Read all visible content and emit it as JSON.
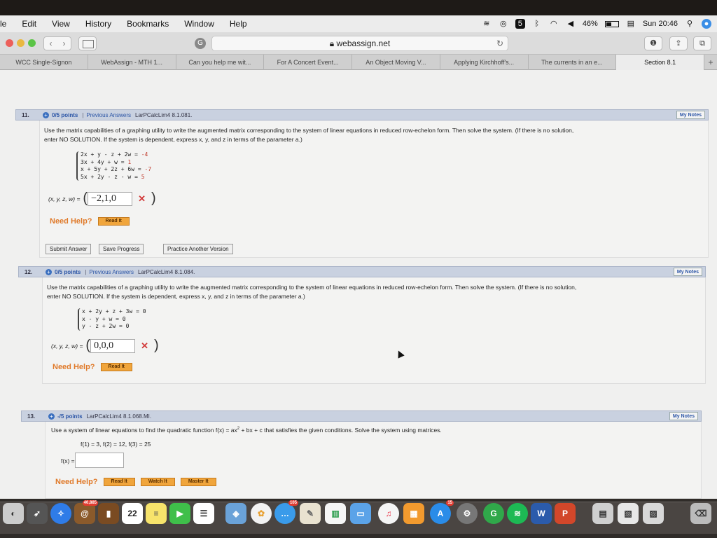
{
  "menubar": {
    "items": [
      "le",
      "Edit",
      "View",
      "History",
      "Bookmarks",
      "Window",
      "Help"
    ],
    "battery": "46%",
    "clock": "Sun 20:46",
    "battery_level": 0.46
  },
  "browser": {
    "url": "webassign.net",
    "tabs": [
      "WCC Single-Signon",
      "WebAssign - MTH 1...",
      "Can you help me wit...",
      "For A Concert Event...",
      "An Object Moving V...",
      "Applying Kirchhoff's...",
      "The currents in an e...",
      "Section 8.1"
    ],
    "active_tab_index": 7
  },
  "q11": {
    "number": "11.",
    "points": "0/5 points",
    "sep": "|",
    "prev": "Previous Answers",
    "source": "LarPCalcLim4 8.1.081.",
    "notes": "My Notes",
    "prompt_line1": "Use the matrix capabilities of a graphing utility to write the augmented matrix corresponding to the system of linear equations in reduced row-echelon form. Then solve the system. (If there is no solution,",
    "prompt_line2": "enter NO SOLUTION. If the system is dependent, express x, y, and z in terms of the parameter a.)",
    "eq1": "2x +  y -   z + 2w = ",
    "eq1_r": "-4",
    "eq2": "3x + 4y          +  w = ",
    "eq2_r": "1",
    "eq3": " x + 5y + 2z + 6w = ",
    "eq3_r": "-7",
    "eq4": "5x + 2y -   z -  w = ",
    "eq4_r": "5",
    "answer_label": "(x, y, z, w) =",
    "answer_value": "−2,1,0",
    "wrong": "✕",
    "need_help": "Need Help?",
    "read_it": "Read It",
    "submit": "Submit Answer",
    "save": "Save Progress",
    "practice": "Practice Another Version"
  },
  "q12": {
    "number": "12.",
    "points": "0/5 points",
    "sep": "|",
    "prev": "Previous Answers",
    "source": "LarPCalcLim4 8.1.084.",
    "notes": "My Notes",
    "prompt_line1": "Use the matrix capabilities of a graphing utility to write the augmented matrix corresponding to the system of linear equations in reduced row-echelon form. Then solve the system. (If there is no solution,",
    "prompt_line2": "enter NO SOLUTION. If the system is dependent, express x, y, and z in terms of the parameter a.)",
    "eq1": "x + 2y +  z + 3w = 0",
    "eq2": "x -   y         +  w = 0",
    "eq3": "      y -  z + 2w = 0",
    "answer_label": "(x, y, z, w) =",
    "answer_value": "0,0,0",
    "wrong": "✕",
    "need_help": "Need Help?",
    "read_it": "Read It"
  },
  "q13": {
    "number": "13.",
    "points": "-/5 points",
    "source": "LarPCalcLim4 8.1.068.MI.",
    "notes": "My Notes",
    "prompt_a": "Use a system of linear equations to find the quadratic function  f(x) = ax",
    "prompt_sup": "2",
    "prompt_b": " + bx + c  that satisfies the given conditions. Solve the system using matrices.",
    "conditions": "f(1) = 3, f(2) = 12, f(3) = 25",
    "fx_label": "f(x) =",
    "need_help": "Need Help?",
    "read_it": "Read It",
    "watch_it": "Watch It",
    "master_it": "Master It"
  },
  "dock": {
    "calendar_day": "22",
    "badge_mail": "105",
    "badge_appstore": "15",
    "badge_contacts": "40,885"
  }
}
